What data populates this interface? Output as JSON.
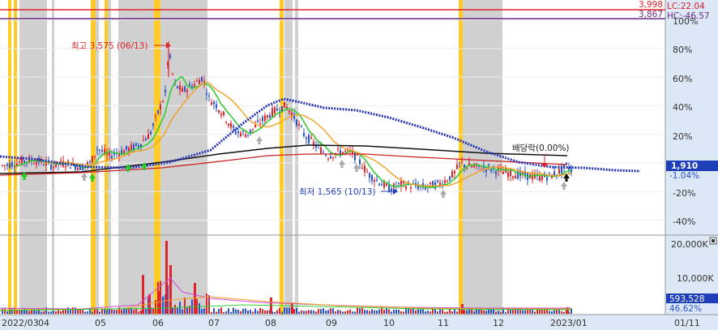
{
  "header_lines": {
    "upper": {
      "value": "3,998",
      "tag": "LC:22.04",
      "color": "#e0222b"
    },
    "lower": {
      "value": "3,867",
      "tag": "HC:-46.57",
      "color": "#6a2b86"
    }
  },
  "y_axis": {
    "price_ticks": [
      "100%",
      "80%",
      "60%",
      "40%",
      "20%",
      "0%",
      "-20%",
      "-40%"
    ],
    "volume_ticks": [
      "20,000K",
      "10,000K"
    ]
  },
  "current": {
    "price": "1,910",
    "change": "-1.04%",
    "volume": "593,528",
    "vol_pct": "46.62%"
  },
  "annotations": {
    "high": "최고 3,575 (06/13)",
    "low": "최저 1,565 (10/13)",
    "dividend": "배당락(0.00%)"
  },
  "x_axis": {
    "labels": [
      "2022/03",
      "04",
      "05",
      "06",
      "07",
      "08",
      "09",
      "10",
      "11",
      "12",
      "2023/01",
      "01/11"
    ]
  },
  "colors": {
    "up": "#e0222b",
    "down": "#2a52c8",
    "ma_green": "#33cc33",
    "ma_orange": "#f2a024",
    "ma_black": "#111111",
    "ma_red": "#cc2222",
    "ma_blue": "#2233bb",
    "shade_grey": "#c8c8c8",
    "shade_yellow": "#ffc81a",
    "axis_bg": "#dce8f6"
  },
  "chart_data": {
    "type": "candlestick-with-volume",
    "price_axis_ticks_pct": [
      100,
      80,
      60,
      40,
      20,
      0,
      -20,
      -40
    ],
    "volume_axis_ticks": [
      "20,000K",
      "10,000K"
    ],
    "high": {
      "price": "3,575",
      "date": "06/13"
    },
    "low": {
      "price": "1,565",
      "date": "10/13"
    },
    "last": {
      "price": "1,910",
      "change_pct": "-1.04%",
      "volume": "593,528"
    },
    "months": [
      "2022/03",
      "04",
      "05",
      "06",
      "07",
      "08",
      "09",
      "10",
      "11",
      "12",
      "2023/01"
    ],
    "series": [
      {
        "name": "MA short",
        "color": "green"
      },
      {
        "name": "MA mid",
        "color": "orange"
      },
      {
        "name": "MA long",
        "color": "black"
      },
      {
        "name": "MA longest",
        "color": "red"
      },
      {
        "name": "Envelope",
        "color": "blue"
      }
    ]
  }
}
